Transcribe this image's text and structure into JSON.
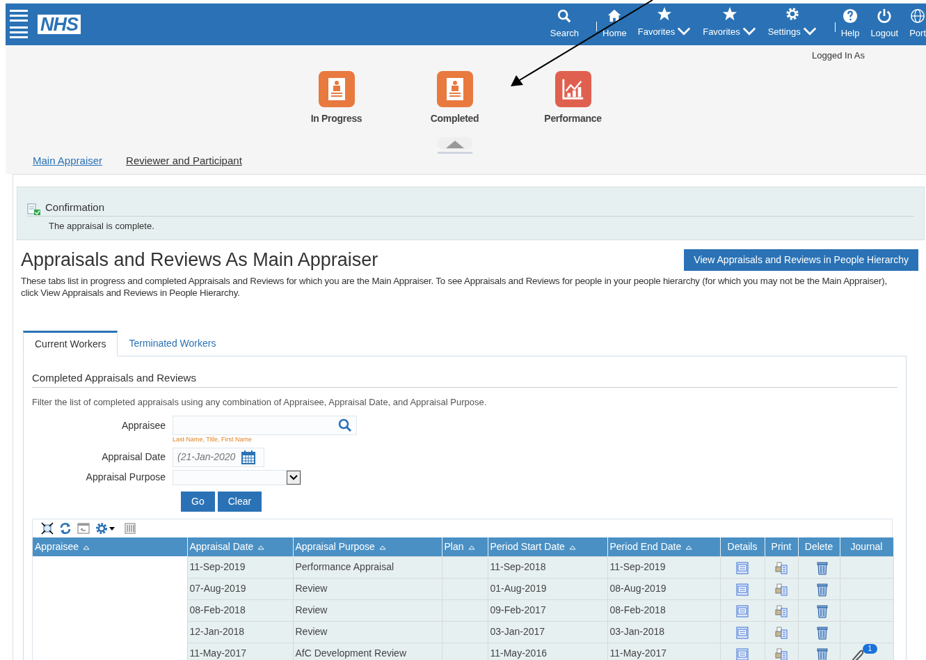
{
  "header": {
    "logo": "NHS",
    "nav": [
      {
        "label": "Search",
        "kind": "search",
        "dropdown": false,
        "divider_after": true
      },
      {
        "label": "Home",
        "kind": "home",
        "dropdown": false,
        "divider_after": false
      },
      {
        "label": "Favorites",
        "kind": "favorites",
        "dropdown": true,
        "divider_after": false
      },
      {
        "label": "Favorites",
        "kind": "favorites",
        "dropdown": true,
        "divider_after": false
      },
      {
        "label": "Settings",
        "kind": "settings",
        "dropdown": true,
        "divider_after": true
      },
      {
        "label": "Help",
        "kind": "help",
        "dropdown": false,
        "divider_after": false
      },
      {
        "label": "Logout",
        "kind": "logout",
        "dropdown": false,
        "divider_after": false
      },
      {
        "label": "Port",
        "kind": "portal",
        "dropdown": false,
        "divider_after": false
      }
    ],
    "logged_in": "Logged In As"
  },
  "springboard": [
    {
      "label": "In Progress",
      "kind": "appraisals",
      "selected": false
    },
    {
      "label": "Completed",
      "kind": "appraisals",
      "selected": true
    },
    {
      "label": "Performance",
      "kind": "performance",
      "selected": false
    }
  ],
  "page_tabs": [
    {
      "label": "Main Appraiser",
      "selected": true
    },
    {
      "label": "Reviewer and Participant",
      "selected": false
    }
  ],
  "confirmation": {
    "title": "Confirmation",
    "message": "The appraisal is complete."
  },
  "heading": "Appraisals and Reviews As Main Appraiser",
  "hierarchy_button": "View Appraisals and Reviews in People Hierarchy",
  "description": "These tabs list in progress and completed Appraisals and Reviews for which you are the Main Appraiser. To see Appraisals and Reviews for people in your people hierarchy (for which you may not be the Main Appraiser), click View Appraisals and Reviews in People Hierarchy.",
  "worker_tabs": [
    {
      "label": "Current Workers",
      "selected": true
    },
    {
      "label": "Terminated Workers",
      "selected": false
    }
  ],
  "section_title": "Completed Appraisals and Reviews",
  "filter_hint": "Filter the list of completed appraisals using any combination of Appraisee, Appraisal Date, and Appraisal Purpose.",
  "filters": [
    {
      "kind": "search",
      "label": "Appraisee",
      "hint": "Last Name, Title, First Name"
    },
    {
      "kind": "date",
      "label": "Appraisal Date",
      "placeholder": "(21-Jan-2020"
    },
    {
      "kind": "select",
      "label": "Appraisal Purpose"
    }
  ],
  "buttons": [
    "Go",
    "Clear"
  ],
  "table": {
    "columns": [
      {
        "label": "Appraisee",
        "sortable": true
      },
      {
        "label": "Appraisal Date",
        "sortable": true
      },
      {
        "label": "Appraisal Purpose",
        "sortable": true
      },
      {
        "label": "Plan",
        "sortable": true
      },
      {
        "label": "Period Start Date",
        "sortable": true
      },
      {
        "label": "Period End Date",
        "sortable": true
      },
      {
        "label": "Details",
        "sortable": false
      },
      {
        "label": "Print",
        "sortable": false
      },
      {
        "label": "Delete",
        "sortable": false
      },
      {
        "label": "Journal",
        "sortable": false
      }
    ],
    "rows": [
      {
        "appraisal_date": "11-Sep-2019",
        "purpose": "Performance Appraisal",
        "start": "11-Sep-2018",
        "end": "11-Sep-2019"
      },
      {
        "appraisal_date": "07-Aug-2019",
        "purpose": "Review",
        "start": "01-Aug-2019",
        "end": "08-Aug-2019"
      },
      {
        "appraisal_date": "08-Feb-2018",
        "purpose": "Review",
        "start": "09-Feb-2017",
        "end": "08-Feb-2018"
      },
      {
        "appraisal_date": "12-Jan-2018",
        "purpose": "Review",
        "start": "03-Jan-2017",
        "end": "03-Jan-2018"
      },
      {
        "appraisal_date": "11-May-2017",
        "purpose": "AfC Development Review",
        "start": "11-May-2016",
        "end": "11-May-2017",
        "journal_count": "1"
      }
    ]
  }
}
